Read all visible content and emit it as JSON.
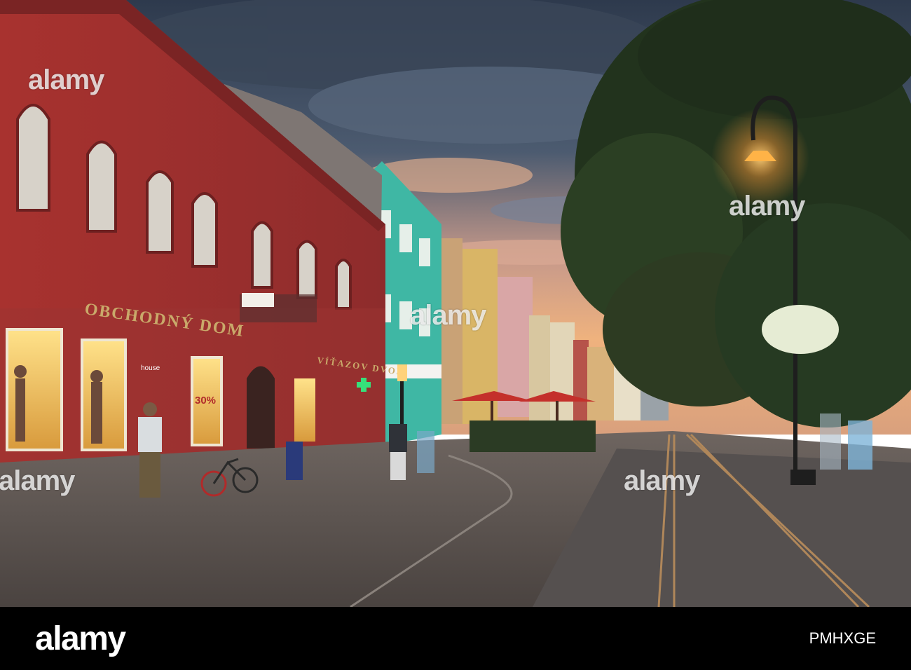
{
  "photo": {
    "signs": {
      "store_name": "OBCHODNÝ DOM",
      "house_name": "VÍŤAZOV DVOR",
      "shop_sign": "house",
      "promo": "30%"
    },
    "colors": {
      "sky_top": "#3b4a5e",
      "sky_glow": "#e9a67a",
      "red_building": "#b23b3b",
      "teal_building": "#3fb7a4",
      "lamp_glow": "#ffb347",
      "pavement": "#6b6460",
      "tree": "#23351f"
    }
  },
  "watermarks": [
    "alamy",
    "alamy",
    "alamy",
    "alamy",
    "alamy"
  ],
  "footer": {
    "logo": "alamy",
    "image_code": "PMHXGE"
  }
}
